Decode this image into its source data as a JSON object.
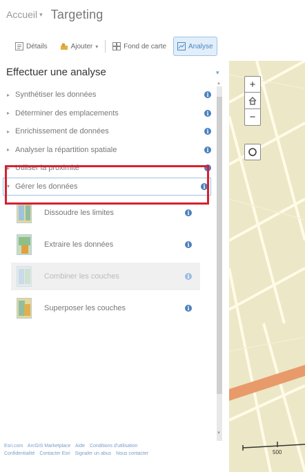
{
  "header": {
    "home_label": "Accueil",
    "home_caret": "▾",
    "title": "Targeting"
  },
  "toolbar": {
    "details_label": "Détails",
    "add_label": "Ajouter",
    "add_caret": "▾",
    "basemap_label": "Fond de carte",
    "analysis_label": "Analyse"
  },
  "panel": {
    "title": "Effectuer une analyse",
    "collapse_glyph": "▾",
    "categories": [
      {
        "label": "Synthétiser les données",
        "arrow": "▸"
      },
      {
        "label": "Déterminer des emplacements",
        "arrow": "▸"
      },
      {
        "label": "Enrichissement de données",
        "arrow": "▸"
      },
      {
        "label": "Analyser la répartition spatiale",
        "arrow": "▸"
      },
      {
        "label": "Utiliser la proximité",
        "arrow": "▸"
      },
      {
        "label": "Gérer les données",
        "arrow": "▾"
      }
    ],
    "tools": [
      {
        "label": "Dissoudre les limites"
      },
      {
        "label": "Extraire les données"
      },
      {
        "label": "Combiner les couches"
      },
      {
        "label": "Superposer les couches"
      }
    ],
    "info_glyph": "i"
  },
  "scrollbar": {
    "up": "▲",
    "down": "▼"
  },
  "footer": {
    "links": [
      "Esri.com",
      "ArcGIS Marketplace",
      "Aide",
      "Conditions d'utilisation",
      "Confidentialité",
      "Contacter Esri",
      "Signaler un abus",
      "Nous contacter"
    ]
  },
  "map": {
    "zoom_in": "+",
    "zoom_out": "−",
    "scale_label": "500"
  },
  "colors": {
    "accent": "#4a7fc0",
    "highlight": "#d6202f",
    "map_bg": "#ece7c6",
    "road_orange": "#e89a6a"
  }
}
